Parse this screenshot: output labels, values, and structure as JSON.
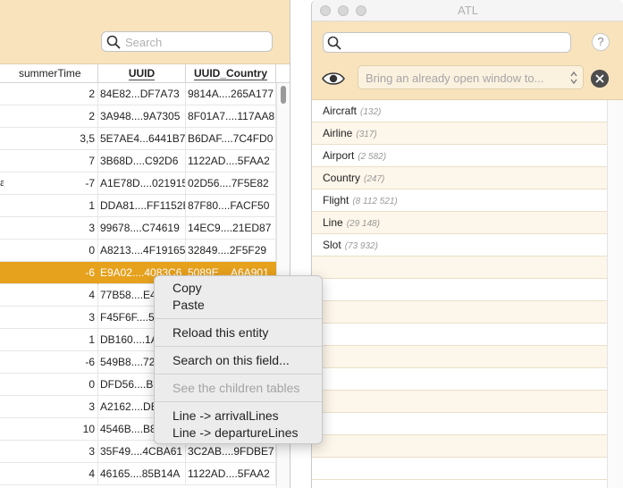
{
  "left": {
    "search_placeholder": "Search",
    "columns": {
      "c1": "summerTime",
      "c2": "UUID",
      "c3": "UUID_Country"
    },
    "rows": [
      {
        "lead": "",
        "n": "2",
        "uuid": "84E82...DF7A73",
        "uuidc": "9814A....265A177"
      },
      {
        "lead": "",
        "n": "2",
        "uuid": "3A948....9A7305",
        "uuidc": "8F01A7....117AA8"
      },
      {
        "lead": "",
        "n": "3,5",
        "uuid": "5E7AE4...6441B7",
        "uuidc": "B6DAF....7C4FD0"
      },
      {
        "lead": "",
        "n": "7",
        "uuid": "3B68D....C92D6",
        "uuidc": "1122AD....5FAA2"
      },
      {
        "lead": "a",
        "n": "-7",
        "uuid": "A1E78D....021915",
        "uuidc": "02D56....7F5E82"
      },
      {
        "lead": "",
        "n": "1",
        "uuid": "DDA81....FF1152E",
        "uuidc": "87F80....FACF50"
      },
      {
        "lead": "",
        "n": "3",
        "uuid": "99678....C74619",
        "uuidc": "14EC9....21ED87"
      },
      {
        "lead": "",
        "n": "0",
        "uuid": "A8213....4F19165",
        "uuidc": "32849....2F5F29"
      },
      {
        "lead": "",
        "n": "-6",
        "uuid": "E9A02....4083C6",
        "uuidc": "5089E....A6A901",
        "selected": true
      },
      {
        "lead": "",
        "n": "4",
        "uuid": "77B58....E4",
        "uuidc": ""
      },
      {
        "lead": "",
        "n": "3",
        "uuid": "F45F6F....54",
        "uuidc": ""
      },
      {
        "lead": "",
        "n": "1",
        "uuid": "DB160....1A",
        "uuidc": ""
      },
      {
        "lead": "",
        "n": "-6",
        "uuid": "549B8....72",
        "uuidc": ""
      },
      {
        "lead": "",
        "n": "0",
        "uuid": "DFD56....BD",
        "uuidc": ""
      },
      {
        "lead": "",
        "n": "3",
        "uuid": "A2162....DE",
        "uuidc": ""
      },
      {
        "lead": "",
        "n": "10",
        "uuid": "4546B....B8",
        "uuidc": ""
      },
      {
        "lead": "",
        "n": "3",
        "uuid": "35F49....4CBA61",
        "uuidc": "3C2AB....9FDBE7"
      },
      {
        "lead": "",
        "n": "4",
        "uuid": "46165....85B14A",
        "uuidc": "1122AD....5FAA2"
      }
    ]
  },
  "right": {
    "window_title": "ATL",
    "help_label": "?",
    "open_window_placeholder": "Bring an already open window to...",
    "entities": [
      {
        "name": "Aircraft",
        "count": "(132)"
      },
      {
        "name": "Airline",
        "count": "(317)"
      },
      {
        "name": "Airport",
        "count": "(2 582)"
      },
      {
        "name": "Country",
        "count": "(247)"
      },
      {
        "name": "Flight",
        "count": "(8 112 521)"
      },
      {
        "name": "Line",
        "count": "(29 148)"
      },
      {
        "name": "Slot",
        "count": "(73 932)"
      }
    ]
  },
  "context_menu": {
    "copy": "Copy",
    "paste": "Paste",
    "reload": "Reload this entity",
    "search_field": "Search on this field...",
    "children_tables": "See the children tables",
    "arrival_lines": "Line -> arrivalLines",
    "departure_lines": "Line -> departureLines"
  },
  "colors": {
    "toolbar_bg": "#f8e3bd",
    "selection": "#e6a11d"
  }
}
